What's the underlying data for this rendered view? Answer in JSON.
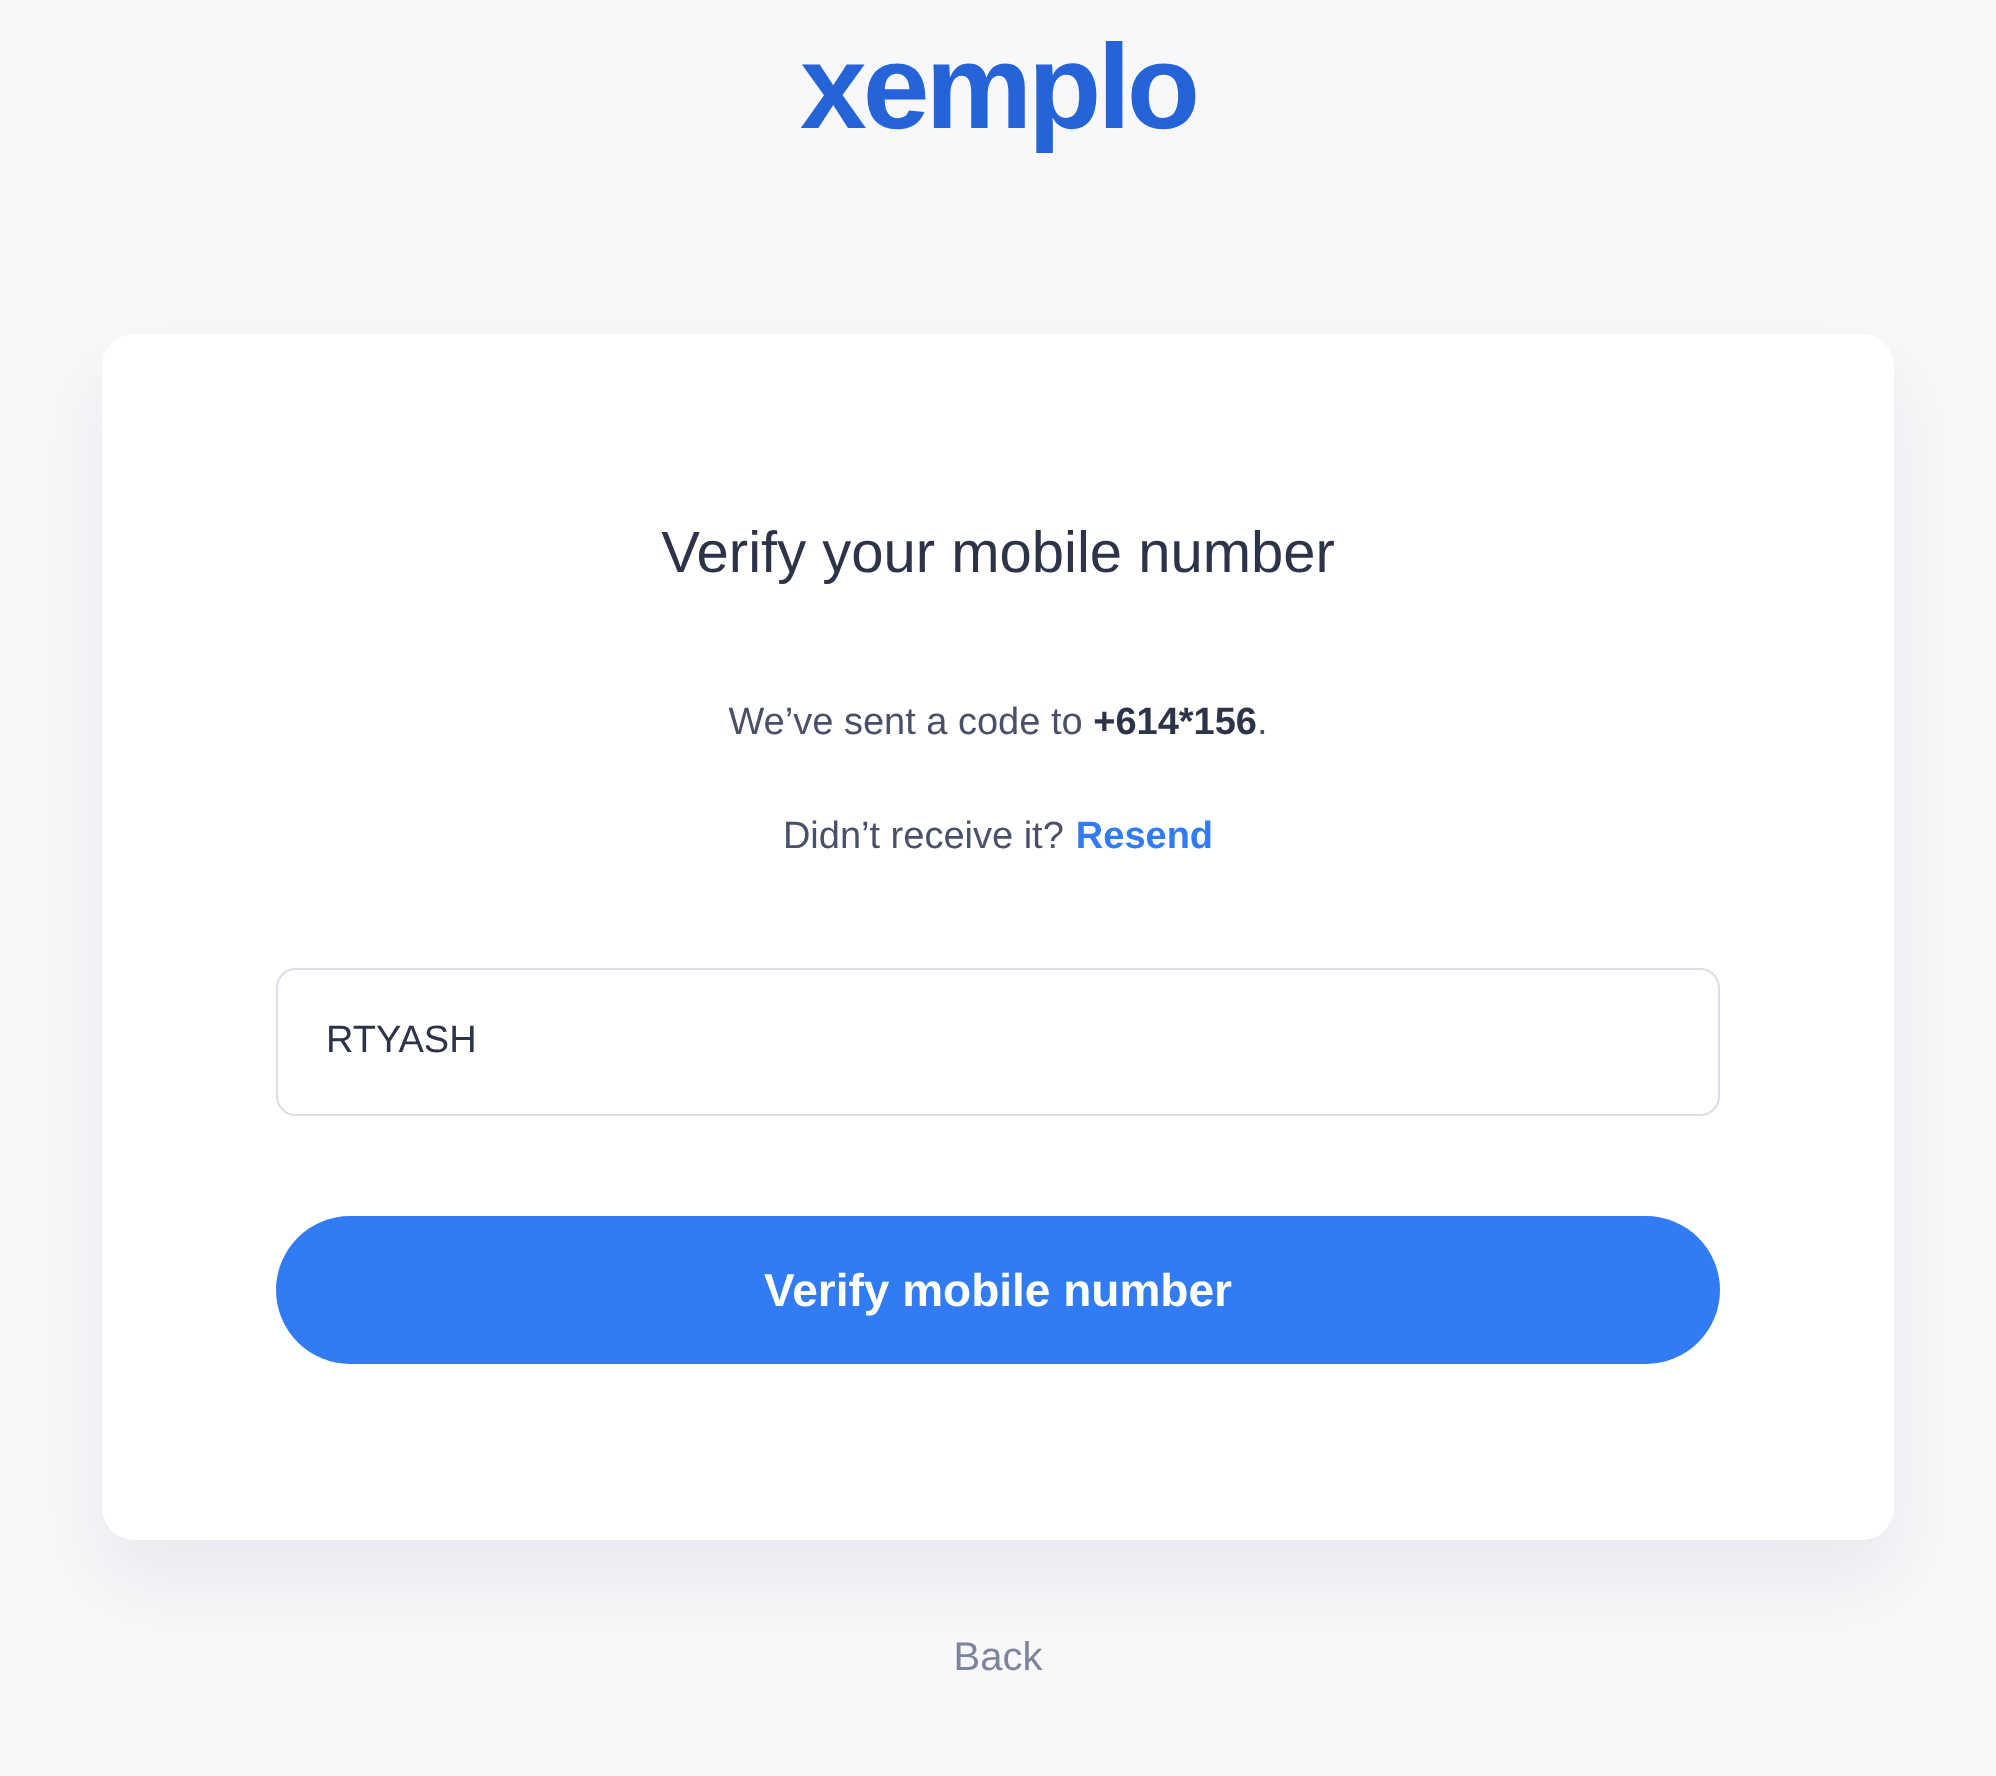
{
  "logo": "xemplo",
  "card": {
    "title": "Verify your mobile number",
    "message": "We’ve sent a code to **+614*****156**.",
    "resend_prompt": "Didn’t receive it?",
    "resend_link": "Resend",
    "code_field": {
      "value": "RTYASH"
    },
    "submit_button": "Verify mobile number"
  },
  "back_link": "Back"
}
